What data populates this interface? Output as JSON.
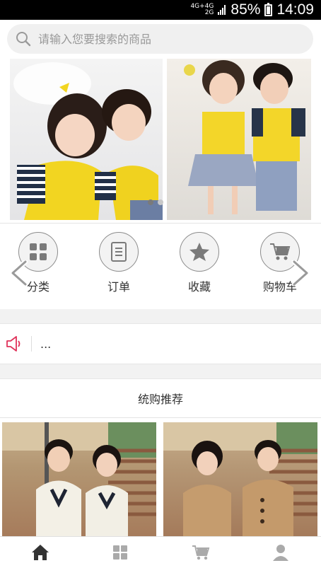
{
  "status": {
    "signal_top": "4G+4G",
    "signal_bottom": "2G",
    "battery": "85%",
    "time": "14:09"
  },
  "search": {
    "placeholder": "请输入您要搜索的商品"
  },
  "banner": {
    "slides": 2,
    "active_slide": 1
  },
  "shortcuts": [
    {
      "label": "分类",
      "icon": "grid-icon"
    },
    {
      "label": "订单",
      "icon": "document-icon"
    },
    {
      "label": "收藏",
      "icon": "star-icon"
    },
    {
      "label": "购物车",
      "icon": "cart-icon"
    }
  ],
  "notice": {
    "text": "..."
  },
  "recommend": {
    "title": "统购推荐"
  },
  "tabbar": [
    {
      "icon": "home-icon",
      "active": true
    },
    {
      "icon": "grid-icon",
      "active": false
    },
    {
      "icon": "cart-icon",
      "active": false
    },
    {
      "icon": "user-icon",
      "active": false
    }
  ],
  "colors": {
    "accent": "#e0325a",
    "active_tab": "#333333",
    "inactive_tab": "#aaaaaa"
  }
}
